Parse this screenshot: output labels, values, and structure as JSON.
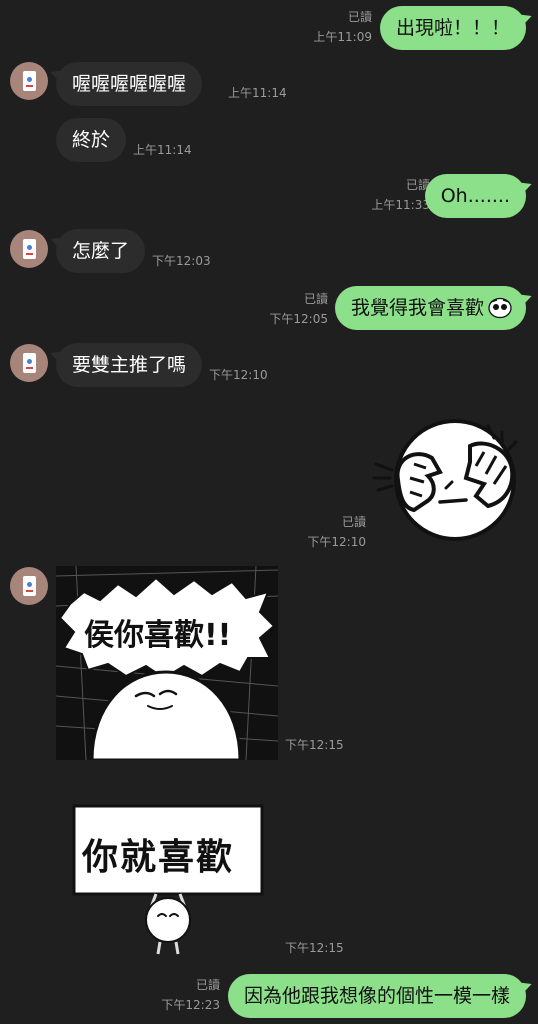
{
  "messages": [
    {
      "side": "sent",
      "text": "出現啦！！！",
      "read": "已讀",
      "time": "上午11:09"
    },
    {
      "side": "recv",
      "text": "喔喔喔喔喔喔",
      "time": "上午11:14"
    },
    {
      "side": "recv",
      "text": "終於",
      "time": "上午11:14"
    },
    {
      "side": "sent",
      "text": "Oh.......",
      "read": "已讀",
      "time": "上午11:33"
    },
    {
      "side": "recv",
      "text": "怎麼了",
      "time": "下午12:03"
    },
    {
      "side": "sent",
      "text": "我覺得我會喜歡",
      "read": "已讀",
      "time": "下午12:05"
    },
    {
      "side": "recv",
      "text": "要雙主推了嗎",
      "time": "下午12:10"
    },
    {
      "side": "sent",
      "sticker": "face-palm-sticker",
      "read": "已讀",
      "time": "下午12:10"
    },
    {
      "side": "recv",
      "sticker": "text-sticker",
      "sticker_text": "侯你喜歡!!",
      "time": "下午12:15"
    },
    {
      "side": "recv",
      "sticker": "sign-sticker",
      "sticker_text": "你就喜歡",
      "time": "下午12:15"
    },
    {
      "side": "sent",
      "text": "因為他跟我想像的個性一模一樣",
      "read": "已讀",
      "time": "下午12:23"
    }
  ],
  "colors": {
    "background": "#1f1f1f",
    "sent": "#8de08a",
    "received": "#2c2c2c",
    "meta": "#9a9a9a"
  }
}
